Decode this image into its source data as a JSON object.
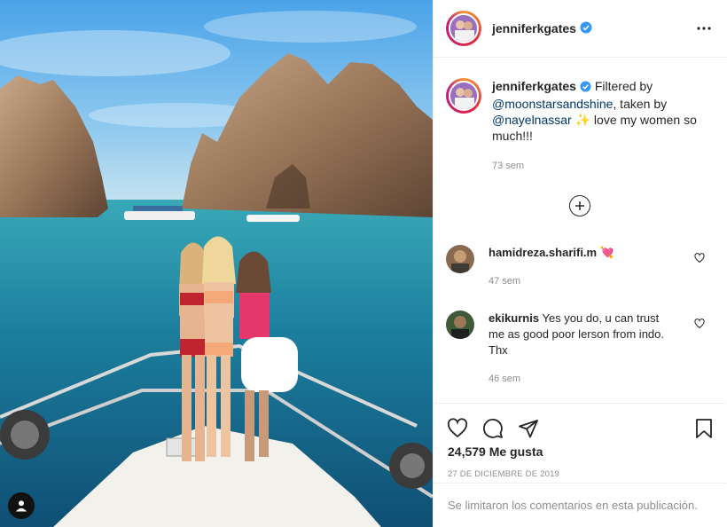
{
  "post": {
    "username": "jenniferkgates",
    "caption": {
      "username": "jenniferkgates",
      "pre": " Filtered by ",
      "mention1": "@moonstarsandshine",
      "mid": ", taken by ",
      "mention2": "@nayelnassar",
      "sparkles": "✨",
      "post": " love my women so much!!!",
      "time": "73 sem"
    },
    "comments": [
      {
        "username": "hamidreza.sharifi.m",
        "text": "💘",
        "time": "47 sem"
      },
      {
        "username": "ekikurnis",
        "text": "Yes you do, u can trust me as good poor lerson from indo. Thx",
        "time": "46 sem"
      }
    ],
    "likes": "24,579 Me gusta",
    "date": "27 DE DICIEMBRE DE 2019",
    "comments_limited": "Se limitaron los comentarios en esta publicación."
  },
  "icons": {
    "verified": "verified-badge-icon",
    "more": "more-options-icon",
    "load_more": "load-more-comments-icon",
    "like": "heart-icon",
    "comment": "comment-icon",
    "share": "share-icon",
    "save": "bookmark-icon",
    "user_tag": "user-tag-icon"
  },
  "colors": {
    "verified": "#3897f0",
    "mention": "#00376b",
    "muted": "#8e8e8e"
  }
}
